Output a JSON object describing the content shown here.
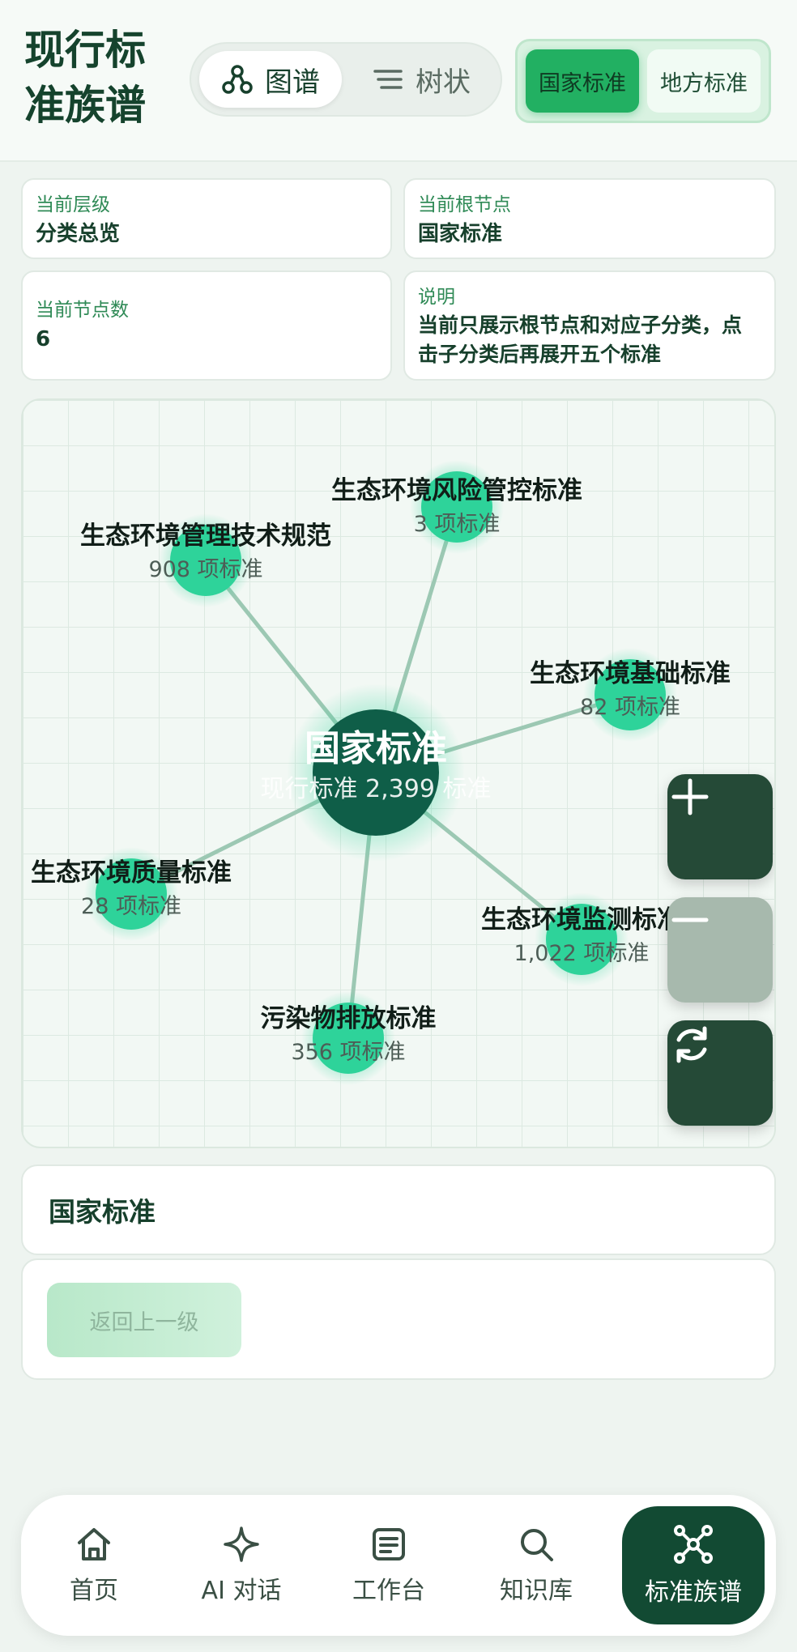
{
  "header": {
    "title": "现行标准族谱",
    "view_toggle": [
      {
        "label": "图谱",
        "icon": "graph-icon",
        "active": true
      },
      {
        "label": "树状",
        "icon": "list-icon",
        "active": false
      }
    ],
    "scope_toggle": [
      {
        "label": "国家标准",
        "active": true
      },
      {
        "label": "地方标准",
        "active": false
      }
    ]
  },
  "info": {
    "level": {
      "label": "当前层级",
      "value": "分类总览"
    },
    "root": {
      "label": "当前根节点",
      "value": "国家标准"
    },
    "node_count": {
      "label": "当前节点数",
      "value": "6"
    },
    "description": {
      "label": "说明",
      "value": "当前只展示根节点和对应子分类，点击子分类后再展开五个标准"
    }
  },
  "graph": {
    "root": {
      "name": "国家标准",
      "count": "现行标准 2,399 标准"
    },
    "nodes": [
      {
        "name": "生态环境风险管控标准",
        "count": "3 项标准"
      },
      {
        "name": "生态环境管理技术规范",
        "count": "908 项标准"
      },
      {
        "name": "生态环境基础标准",
        "count": "82 项标准"
      },
      {
        "name": "生态环境质量标准",
        "count": "28 项标准"
      },
      {
        "name": "生态环境监测标准",
        "count": "1,022 项标准"
      },
      {
        "name": "污染物排放标准",
        "count": "356 项标准"
      }
    ],
    "controls": {
      "zoom_in": "+",
      "zoom_out": "−",
      "reset": "reset-icon"
    },
    "colors": {
      "root": "#0f5e48",
      "node": "#2ed39a",
      "edge": "#9cc8b3"
    }
  },
  "selected": {
    "title": "国家标准"
  },
  "back_button": {
    "label": "返回上一级"
  },
  "bottom_nav": [
    {
      "label": "首页",
      "icon": "home-icon",
      "active": false
    },
    {
      "label": "AI 对话",
      "icon": "sparkle-icon",
      "active": false
    },
    {
      "label": "工作台",
      "icon": "document-icon",
      "active": false
    },
    {
      "label": "知识库",
      "icon": "search-icon",
      "active": false
    },
    {
      "label": "标准族谱",
      "icon": "network-icon",
      "active": true
    }
  ]
}
